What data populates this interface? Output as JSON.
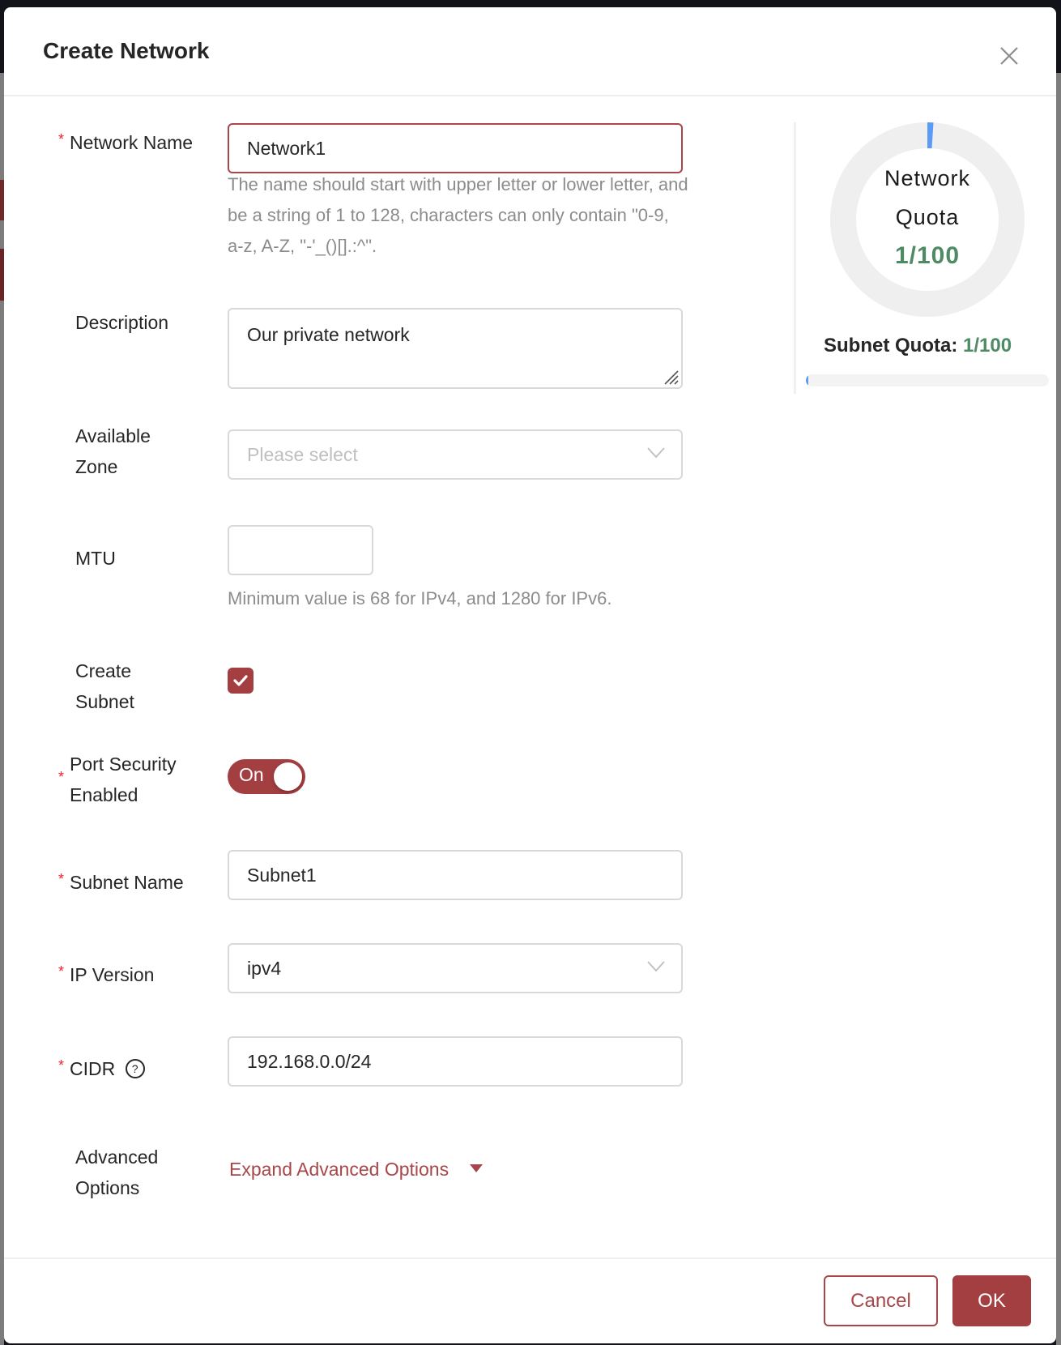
{
  "modal": {
    "title": "Create Network",
    "close_icon": "close-icon"
  },
  "form": {
    "network_name": {
      "label": "Network Name",
      "required": true,
      "value": "Network1",
      "help": "The name should start with upper letter or lower letter, and be a string of 1 to 128, characters can only contain \"0-9, a-z, A-Z, \"-'_()[].:^\"."
    },
    "description": {
      "label": "Description",
      "value": "Our private network"
    },
    "available_zone": {
      "label_line1": "Available",
      "label_line2": "Zone",
      "placeholder": "Please select",
      "value": ""
    },
    "mtu": {
      "label": "MTU",
      "value": "",
      "help": "Minimum value is 68 for IPv4, and 1280 for IPv6."
    },
    "create_subnet": {
      "label_line1": "Create",
      "label_line2": "Subnet",
      "checked": true
    },
    "port_security": {
      "label_line1": "Port Security",
      "label_line2": "Enabled",
      "required": true,
      "toggle_text": "On",
      "on": true
    },
    "subnet_name": {
      "label": "Subnet Name",
      "required": true,
      "value": "Subnet1"
    },
    "ip_version": {
      "label": "IP Version",
      "required": true,
      "value": "ipv4"
    },
    "cidr": {
      "label": "CIDR",
      "required": true,
      "value": "192.168.0.0/24",
      "help_icon": "question-circle-icon"
    },
    "advanced": {
      "label_line1": "Advanced",
      "label_line2": "Options",
      "link": "Expand Advanced Options"
    }
  },
  "quota": {
    "network_label_line1": "Network",
    "network_label_line2": "Quota",
    "network_used": 1,
    "network_total": 100,
    "network_value": "1/100",
    "subnet_label": "Subnet Quota:",
    "subnet_value": "1/100",
    "subnet_used": 1,
    "subnet_total": 100
  },
  "footer": {
    "cancel": "Cancel",
    "ok": "OK"
  },
  "colors": {
    "primary": "#a33e41",
    "quota_value": "#4e8a64",
    "quota_used": "#5b9bf8",
    "required_star": "#f5222d"
  }
}
